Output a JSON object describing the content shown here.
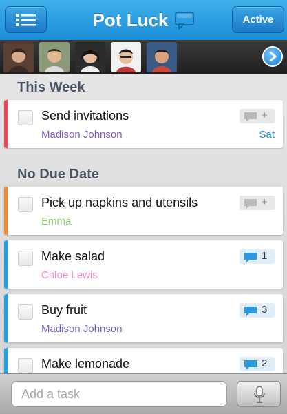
{
  "header": {
    "title": "Pot Luck",
    "active_label": "Active"
  },
  "avatars": [
    {
      "name": "avatar-1"
    },
    {
      "name": "avatar-2"
    },
    {
      "name": "avatar-3"
    },
    {
      "name": "avatar-4"
    },
    {
      "name": "avatar-5"
    }
  ],
  "sections": [
    {
      "title": "This Week",
      "tasks": [
        {
          "title": "Send invitations",
          "assignee": "Madison Johnson",
          "assignee_color": "#7b5cc8",
          "stripe_color": "#f0444f",
          "comments": "+",
          "has_comments": false,
          "due": "Sat"
        }
      ]
    },
    {
      "title": "No Due Date",
      "tasks": [
        {
          "title": "Pick up napkins and utensils",
          "assignee": "Emma",
          "assignee_color": "#8fd16a",
          "stripe_color": "#f08a2c",
          "comments": "+",
          "has_comments": false,
          "due": ""
        },
        {
          "title": "Make salad",
          "assignee": "Chloe Lewis",
          "assignee_color": "#f08cc8",
          "stripe_color": "#1aa3e8",
          "comments": "1",
          "has_comments": true,
          "due": ""
        },
        {
          "title": "Buy fruit",
          "assignee": "Madison Johnson",
          "assignee_color": "#7b5cc8",
          "stripe_color": "#1aa3e8",
          "comments": "3",
          "has_comments": true,
          "due": ""
        },
        {
          "title": "Make lemonade",
          "assignee": "",
          "assignee_color": "#7b5cc8",
          "stripe_color": "#1aa3e8",
          "comments": "2",
          "has_comments": true,
          "due": ""
        }
      ]
    }
  ],
  "footer": {
    "placeholder": "Add a task"
  }
}
